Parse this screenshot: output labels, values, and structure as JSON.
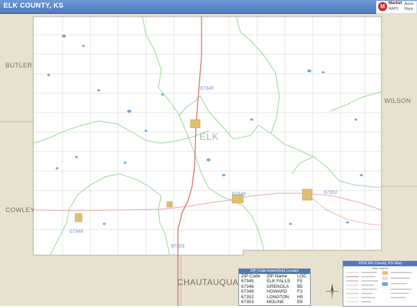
{
  "header": {
    "title": "ELK COUNTY, KS"
  },
  "logo": {
    "mark": "M",
    "line1": "Market",
    "line2": "MAPS",
    "line3": "Aerial",
    "line4": "Maps"
  },
  "neighbors": {
    "butler": "BUTLER",
    "wilson": "WILSON",
    "cowley": "COWLEY",
    "chautauqua": "CHAUTAUQUA"
  },
  "county_label": "ELK",
  "zip_labels": {
    "a": "67345",
    "b": "67346",
    "c": "67349",
    "d": "67352",
    "e": "67353"
  },
  "zip_table": {
    "heading": "ZIP Code Index/Grid Locator",
    "columns": [
      "ZIP Code",
      "ZIP Name",
      "LOC"
    ],
    "rows": [
      [
        "67345",
        "ELK FALLS",
        "F5"
      ],
      [
        "67346",
        "GRENOLA",
        "B5"
      ],
      [
        "67349",
        "HOWARD",
        "F3"
      ],
      [
        "67352",
        "LONGTON",
        "H5"
      ],
      [
        "67353",
        "MOLINE",
        "E6"
      ]
    ]
  },
  "legend": {
    "heading": "2016 Elk County, KS Map",
    "subheading": "Map Legend"
  },
  "colors": {
    "title_bar": "#4f79bd",
    "county_outside": "#e8e1cd",
    "zip_boundary": "#8fd88f",
    "highway": "#d85c5c",
    "water": "#6aa3dc",
    "town": "#e0c070"
  }
}
